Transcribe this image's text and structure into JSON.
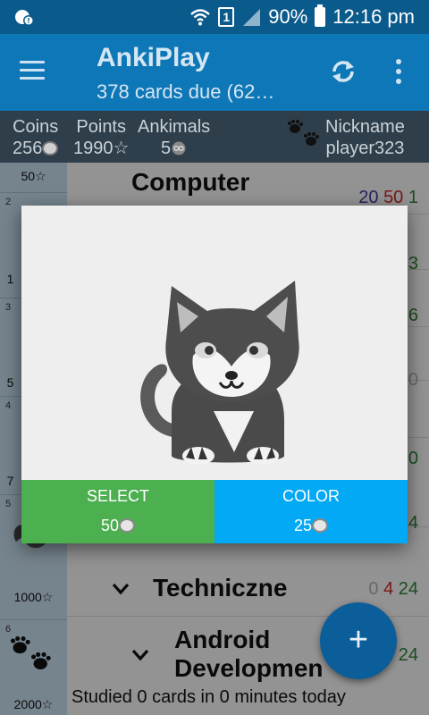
{
  "status_bar": {
    "battery": "90%",
    "time": "12:16 pm",
    "sim_label": "1"
  },
  "app_bar": {
    "title": "AnkiPlay",
    "subtitle": "378 cards due (62…"
  },
  "stats": {
    "coins_label": "Coins",
    "coins_value": "256",
    "points_label": "Points",
    "points_value": "1990☆",
    "ankimals_label": "Ankimals",
    "ankimals_value": "5",
    "nickname_label": "Nickname",
    "nickname_value": "player323"
  },
  "sidebar": {
    "items": [
      {
        "num": "",
        "price": "50☆"
      },
      {
        "num": "2",
        "price": "1"
      },
      {
        "num": "3",
        "price": "5"
      },
      {
        "num": "4",
        "price": "7"
      },
      {
        "num": "5",
        "price": "1000☆"
      },
      {
        "num": "6",
        "price": "2000☆"
      }
    ]
  },
  "decks": [
    {
      "name": "Computer",
      "new": "20",
      "learn": "50",
      "review": "1"
    },
    {
      "name": "Techniczne",
      "new": "0",
      "learn": "4",
      "review": "24"
    },
    {
      "name": "Android Developmen",
      "new": "",
      "learn": "",
      "review": "24"
    }
  ],
  "hidden_counts": [
    "3",
    "6",
    "0",
    "0",
    "4"
  ],
  "footer": {
    "studied_text": "Studied 0 cards in 0 minutes today"
  },
  "dialog": {
    "select_label": "SELECT",
    "select_price": "50",
    "color_label": "COLOR",
    "color_price": "25"
  },
  "colors": {
    "status_bar": "#0b5a8c",
    "app_bar": "#0e77b8",
    "stats_bar": "#2e3e4a",
    "select_button": "#4caf50",
    "color_button": "#03a9f4",
    "fab": "#0b5e99"
  },
  "icons": {
    "menu": "hamburger-icon",
    "sync": "sync-icon",
    "overflow": "more-vert-icon",
    "add": "plus-icon",
    "coin": "coin-icon",
    "ankimal": "cat-icon"
  }
}
